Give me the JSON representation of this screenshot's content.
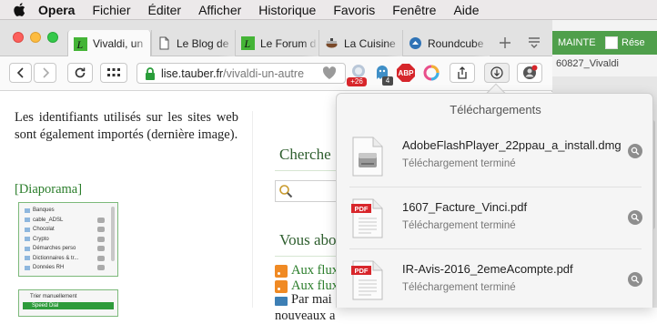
{
  "menubar": {
    "items": [
      "Opera",
      "Fichier",
      "Éditer",
      "Afficher",
      "Historique",
      "Favoris",
      "Fenêtre",
      "Aide"
    ]
  },
  "background_window": {
    "tab1": "MAINTE",
    "tab2": "Rése",
    "url_fragment": "60827_Vivaldi"
  },
  "tabs": [
    {
      "label": "Vivaldi, un"
    },
    {
      "label": "Le Blog de"
    },
    {
      "label": "Le Forum d"
    },
    {
      "label": "La Cuisine"
    },
    {
      "label": "Roundcube"
    }
  ],
  "toolbar": {
    "url_host": "lise.tauber.fr",
    "url_path": "/vivaldi-un-autre",
    "badge_count_1": "+26",
    "badge_count_2": "4",
    "abp_label": "ABP"
  },
  "page": {
    "paragraph": "Les identifiants utilisés sur les sites web sont également importés (dernière image).",
    "diaporama_link": "[Diaporama]",
    "thumb1_rows": [
      "Banques",
      "cable_ADSL",
      "Chocolat",
      "Crypto",
      "Démarches perso",
      "Dictionnaires & tr...",
      "Données RH"
    ],
    "thumb2_header": "Trier manuellement",
    "thumb2_item": "Speed Dial",
    "search_heading": "Cherche",
    "about_heading": "Vous abo",
    "flux1": "Aux flux",
    "flux2": "Aux flux",
    "mail_line1": "Par mai",
    "mail_line2": "nouveaux a"
  },
  "downloads": {
    "title": "Téléchargements",
    "items": [
      {
        "filename": "AdobeFlashPlayer_22ppau_a_install.dmg",
        "status": "Téléchargement terminé",
        "type": "dmg"
      },
      {
        "filename": "1607_Facture_Vinci.pdf",
        "status": "Téléchargement terminé",
        "type": "pdf"
      },
      {
        "filename": "IR-Avis-2016_2emeAcompte.pdf",
        "status": "Téléchargement terminé",
        "type": "pdf"
      }
    ]
  },
  "colors": {
    "accent_green": "#4f9f4b",
    "link_green": "#2a7d2a",
    "pdf_red": "#d8262b",
    "abp_red": "#d6262b"
  }
}
